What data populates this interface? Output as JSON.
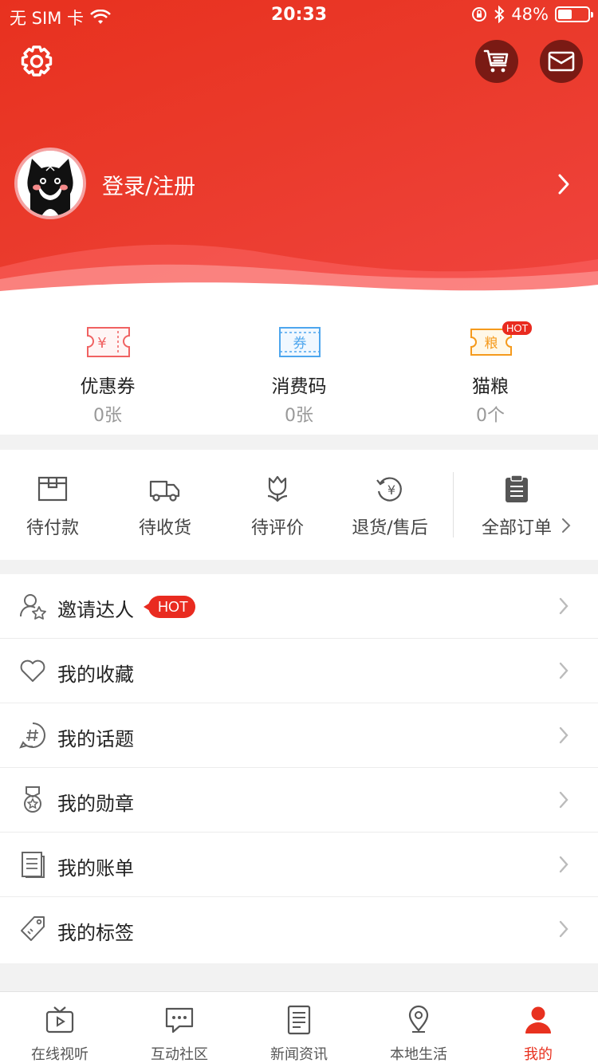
{
  "status_bar": {
    "carrier": "无 SIM 卡",
    "time": "20:33",
    "battery_text": "48%",
    "battery_level": 0.48
  },
  "header": {
    "login_label": "登录/注册"
  },
  "stats": [
    {
      "label": "优惠券",
      "count": "0张",
      "icon": "coupon-icon"
    },
    {
      "label": "消费码",
      "count": "0张",
      "icon": "voucher-icon"
    },
    {
      "label": "猫粮",
      "count": "0个",
      "icon": "cat-food-icon",
      "badge": "HOT",
      "icon_text": "粮"
    }
  ],
  "coupon_icon_text": "¥",
  "voucher_icon_text": "券",
  "orders": [
    {
      "label": "待付款",
      "icon": "wallet-icon"
    },
    {
      "label": "待收货",
      "icon": "truck-icon"
    },
    {
      "label": "待评价",
      "icon": "flower-icon"
    },
    {
      "label": "退货/售后",
      "icon": "refund-icon"
    }
  ],
  "all_orders_label": "全部订单",
  "menu": [
    {
      "label": "邀请达人",
      "icon": "invite-icon",
      "badge": "HOT"
    },
    {
      "label": "我的收藏",
      "icon": "heart-icon"
    },
    {
      "label": "我的话题",
      "icon": "hashtag-icon"
    },
    {
      "label": "我的勋章",
      "icon": "medal-icon"
    },
    {
      "label": "我的账单",
      "icon": "bill-icon"
    },
    {
      "label": "我的标签",
      "icon": "tag-icon"
    }
  ],
  "tabs": [
    {
      "label": "在线视听",
      "icon": "tv-icon"
    },
    {
      "label": "互动社区",
      "icon": "chat-icon"
    },
    {
      "label": "新闻资讯",
      "icon": "news-icon"
    },
    {
      "label": "本地生活",
      "icon": "location-icon"
    },
    {
      "label": "我的",
      "icon": "user-icon",
      "active": true
    }
  ],
  "colors": {
    "brand_red": "#e8311f",
    "dark_button": "#7a1a14",
    "gray_text": "#999999"
  }
}
